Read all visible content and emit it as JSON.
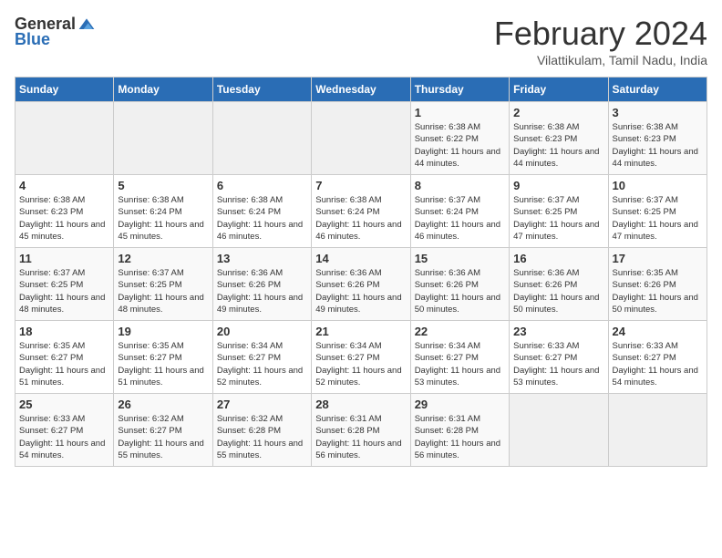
{
  "logo": {
    "general": "General",
    "blue": "Blue"
  },
  "title": "February 2024",
  "subtitle": "Vilattikulam, Tamil Nadu, India",
  "days_of_week": [
    "Sunday",
    "Monday",
    "Tuesday",
    "Wednesday",
    "Thursday",
    "Friday",
    "Saturday"
  ],
  "weeks": [
    [
      {
        "day": "",
        "info": ""
      },
      {
        "day": "",
        "info": ""
      },
      {
        "day": "",
        "info": ""
      },
      {
        "day": "",
        "info": ""
      },
      {
        "day": "1",
        "info": "Sunrise: 6:38 AM\nSunset: 6:22 PM\nDaylight: 11 hours and 44 minutes."
      },
      {
        "day": "2",
        "info": "Sunrise: 6:38 AM\nSunset: 6:23 PM\nDaylight: 11 hours and 44 minutes."
      },
      {
        "day": "3",
        "info": "Sunrise: 6:38 AM\nSunset: 6:23 PM\nDaylight: 11 hours and 44 minutes."
      }
    ],
    [
      {
        "day": "4",
        "info": "Sunrise: 6:38 AM\nSunset: 6:23 PM\nDaylight: 11 hours and 45 minutes."
      },
      {
        "day": "5",
        "info": "Sunrise: 6:38 AM\nSunset: 6:24 PM\nDaylight: 11 hours and 45 minutes."
      },
      {
        "day": "6",
        "info": "Sunrise: 6:38 AM\nSunset: 6:24 PM\nDaylight: 11 hours and 46 minutes."
      },
      {
        "day": "7",
        "info": "Sunrise: 6:38 AM\nSunset: 6:24 PM\nDaylight: 11 hours and 46 minutes."
      },
      {
        "day": "8",
        "info": "Sunrise: 6:37 AM\nSunset: 6:24 PM\nDaylight: 11 hours and 46 minutes."
      },
      {
        "day": "9",
        "info": "Sunrise: 6:37 AM\nSunset: 6:25 PM\nDaylight: 11 hours and 47 minutes."
      },
      {
        "day": "10",
        "info": "Sunrise: 6:37 AM\nSunset: 6:25 PM\nDaylight: 11 hours and 47 minutes."
      }
    ],
    [
      {
        "day": "11",
        "info": "Sunrise: 6:37 AM\nSunset: 6:25 PM\nDaylight: 11 hours and 48 minutes."
      },
      {
        "day": "12",
        "info": "Sunrise: 6:37 AM\nSunset: 6:25 PM\nDaylight: 11 hours and 48 minutes."
      },
      {
        "day": "13",
        "info": "Sunrise: 6:36 AM\nSunset: 6:26 PM\nDaylight: 11 hours and 49 minutes."
      },
      {
        "day": "14",
        "info": "Sunrise: 6:36 AM\nSunset: 6:26 PM\nDaylight: 11 hours and 49 minutes."
      },
      {
        "day": "15",
        "info": "Sunrise: 6:36 AM\nSunset: 6:26 PM\nDaylight: 11 hours and 50 minutes."
      },
      {
        "day": "16",
        "info": "Sunrise: 6:36 AM\nSunset: 6:26 PM\nDaylight: 11 hours and 50 minutes."
      },
      {
        "day": "17",
        "info": "Sunrise: 6:35 AM\nSunset: 6:26 PM\nDaylight: 11 hours and 50 minutes."
      }
    ],
    [
      {
        "day": "18",
        "info": "Sunrise: 6:35 AM\nSunset: 6:27 PM\nDaylight: 11 hours and 51 minutes."
      },
      {
        "day": "19",
        "info": "Sunrise: 6:35 AM\nSunset: 6:27 PM\nDaylight: 11 hours and 51 minutes."
      },
      {
        "day": "20",
        "info": "Sunrise: 6:34 AM\nSunset: 6:27 PM\nDaylight: 11 hours and 52 minutes."
      },
      {
        "day": "21",
        "info": "Sunrise: 6:34 AM\nSunset: 6:27 PM\nDaylight: 11 hours and 52 minutes."
      },
      {
        "day": "22",
        "info": "Sunrise: 6:34 AM\nSunset: 6:27 PM\nDaylight: 11 hours and 53 minutes."
      },
      {
        "day": "23",
        "info": "Sunrise: 6:33 AM\nSunset: 6:27 PM\nDaylight: 11 hours and 53 minutes."
      },
      {
        "day": "24",
        "info": "Sunrise: 6:33 AM\nSunset: 6:27 PM\nDaylight: 11 hours and 54 minutes."
      }
    ],
    [
      {
        "day": "25",
        "info": "Sunrise: 6:33 AM\nSunset: 6:27 PM\nDaylight: 11 hours and 54 minutes."
      },
      {
        "day": "26",
        "info": "Sunrise: 6:32 AM\nSunset: 6:27 PM\nDaylight: 11 hours and 55 minutes."
      },
      {
        "day": "27",
        "info": "Sunrise: 6:32 AM\nSunset: 6:28 PM\nDaylight: 11 hours and 55 minutes."
      },
      {
        "day": "28",
        "info": "Sunrise: 6:31 AM\nSunset: 6:28 PM\nDaylight: 11 hours and 56 minutes."
      },
      {
        "day": "29",
        "info": "Sunrise: 6:31 AM\nSunset: 6:28 PM\nDaylight: 11 hours and 56 minutes."
      },
      {
        "day": "",
        "info": ""
      },
      {
        "day": "",
        "info": ""
      }
    ]
  ]
}
